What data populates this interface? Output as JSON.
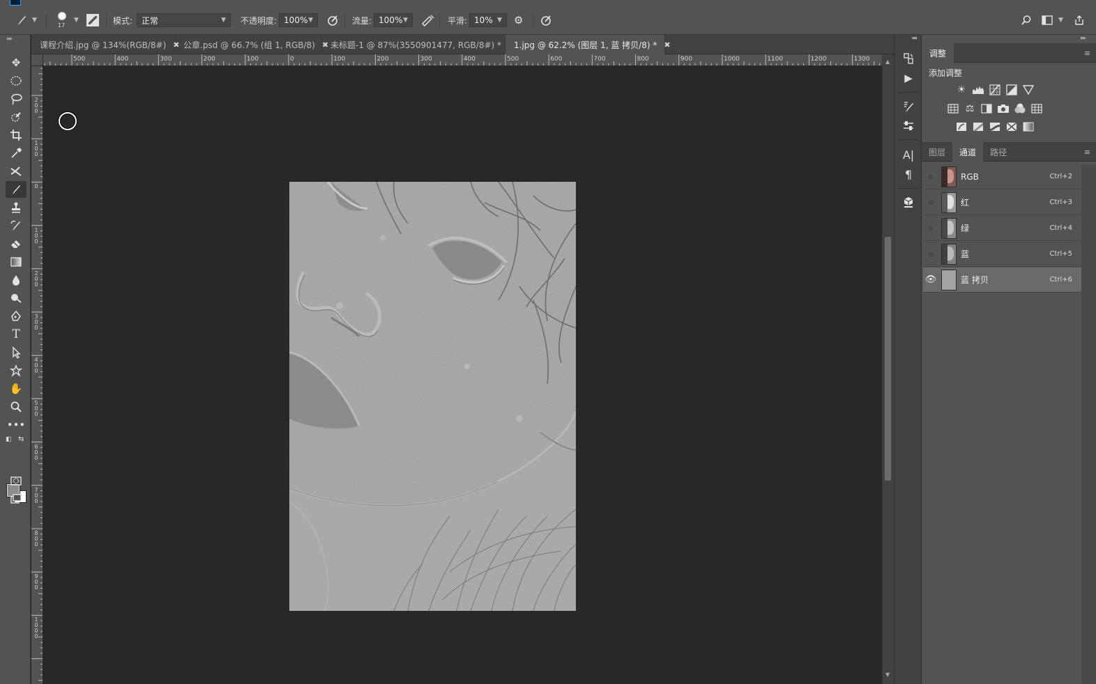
{
  "optionsBar": {
    "brushSize": "17",
    "modeLabel": "模式:",
    "modeValue": "正常",
    "opacityLabel": "不透明度:",
    "opacityValue": "100%",
    "flowLabel": "流量:",
    "flowValue": "100%",
    "smoothLabel": "平滑:",
    "smoothValue": "10%"
  },
  "tabs": [
    {
      "label": "课程介绍.jpg @ 134%(RGB/8#)"
    },
    {
      "label": "公章.psd @ 66.7% (组 1, RGB/8)"
    },
    {
      "label": "未标题-1 @ 87%(3550901477, RGB/8#) *"
    },
    {
      "label": "1.jpg @ 62.2% (图层 1, 蓝 拷贝/8) *"
    }
  ],
  "rulerH": [
    "500",
    "400",
    "300",
    "200",
    "100",
    "0",
    "100",
    "200",
    "300",
    "400",
    "500",
    "600",
    "700",
    "800",
    "900",
    "1000",
    "1100",
    "1200",
    "1300"
  ],
  "rulerV": [
    [
      "2",
      "0",
      "0"
    ],
    [
      "1",
      "0",
      "0"
    ],
    [
      "0"
    ],
    [
      "1",
      "0",
      "0"
    ],
    [
      "2",
      "0",
      "0"
    ],
    [
      "3",
      "0",
      "0"
    ],
    [
      "4",
      "0",
      "0"
    ],
    [
      "5",
      "0",
      "0"
    ],
    [
      "6",
      "0",
      "0"
    ],
    [
      "7",
      "0",
      "0"
    ],
    [
      "8",
      "0",
      "0"
    ],
    [
      "9",
      "0",
      "0"
    ],
    [
      "1",
      "0",
      "0",
      "0"
    ]
  ],
  "adjustPanel": {
    "tab": "调整",
    "title": "添加调整"
  },
  "channelsPanel": {
    "tabs": [
      "图层",
      "通道",
      "路径"
    ],
    "activeTab": 1,
    "rows": [
      {
        "name": "RGB",
        "shortcut": "Ctrl+2",
        "visible": false,
        "selected": false
      },
      {
        "name": "红",
        "shortcut": "Ctrl+3",
        "visible": false,
        "selected": false
      },
      {
        "name": "绿",
        "shortcut": "Ctrl+4",
        "visible": false,
        "selected": false
      },
      {
        "name": "蓝",
        "shortcut": "Ctrl+5",
        "visible": false,
        "selected": false
      },
      {
        "name": "蓝 拷贝",
        "shortcut": "Ctrl+6",
        "visible": true,
        "selected": true
      }
    ]
  },
  "colors": {
    "foreground": "#8c8c8c",
    "background": "#ffffff"
  }
}
